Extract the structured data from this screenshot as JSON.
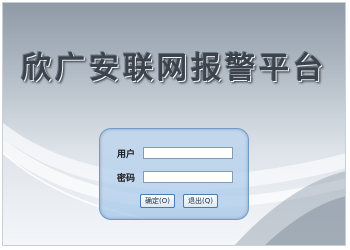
{
  "app": {
    "title": "欣广安联网报警平台"
  },
  "login": {
    "username_label": "用户",
    "username_value": "",
    "password_label": "密码",
    "password_value": "",
    "ok_label": "确定(O)",
    "exit_label": "退出(Q)"
  }
}
